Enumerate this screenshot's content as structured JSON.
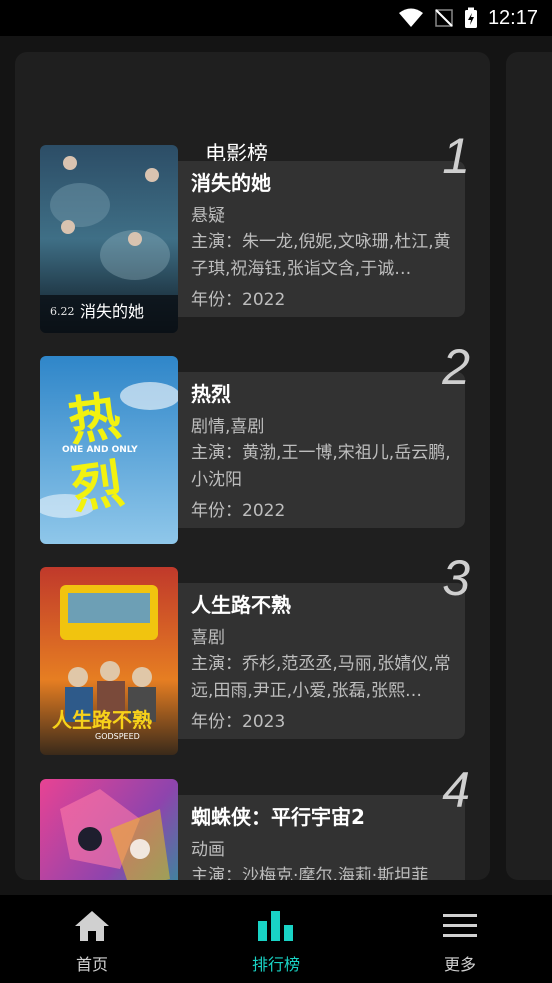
{
  "status_bar": {
    "time": "12:17"
  },
  "panel": {
    "title": "电影榜"
  },
  "movies": [
    {
      "rank": "1",
      "title": "消失的她",
      "genre": "悬疑",
      "cast": "主演：朱一龙,倪妮,文咏珊,杜江,黄子琪,祝海钰,张诣文含,于诚…",
      "year": "年份：2022"
    },
    {
      "rank": "2",
      "title": "热烈",
      "genre": "剧情,喜剧",
      "cast": "主演：黄渤,王一博,宋祖儿,岳云鹏,小沈阳",
      "year": "年份：2022"
    },
    {
      "rank": "3",
      "title": "人生路不熟",
      "genre": "喜剧",
      "cast": "主演：乔杉,范丞丞,马丽,张婧仪,常远,田雨,尹正,小爱,张磊,张熙…",
      "year": "年份：2023"
    },
    {
      "rank": "4",
      "title": "蜘蛛侠：平行宇宙2",
      "genre": "动画",
      "cast": "主演：沙梅克·摩尔,海莉·斯坦菲",
      "year": ""
    }
  ],
  "bottom_nav": {
    "home": "首页",
    "ranking": "排行榜",
    "more": "更多"
  },
  "colors": {
    "accent": "#19d3c5",
    "background": "#141414",
    "card": "#323232"
  }
}
